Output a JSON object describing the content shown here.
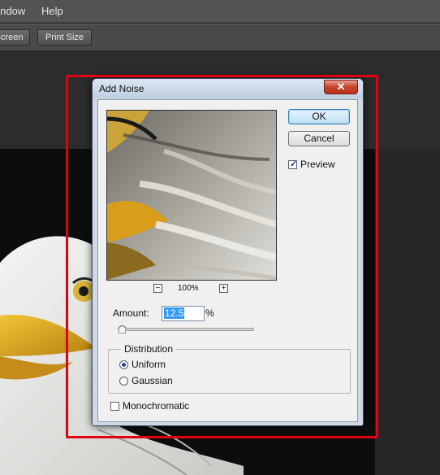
{
  "menubar": {
    "items": [
      "Window",
      "Help"
    ]
  },
  "options_bar": {
    "buttons": [
      "Fill Screen",
      "Print Size"
    ]
  },
  "dialog": {
    "title": "Add Noise",
    "close_glyph": "✕",
    "ok_label": "OK",
    "cancel_label": "Cancel",
    "preview_label": "Preview",
    "preview_checked": true,
    "zoom_minus": "−",
    "zoom_plus": "+",
    "zoom_level": "100%",
    "amount_label": "Amount:",
    "amount_value": "12.5",
    "amount_unit": "%",
    "slider_fraction": 0.03,
    "distribution_title": "Distribution",
    "distribution_options": [
      "Uniform",
      "Gaussian"
    ],
    "distribution_selected": "Uniform",
    "monochromatic_label": "Monochromatic",
    "monochromatic_checked": false
  },
  "colors": {
    "highlight": "#e00012",
    "accent_blue": "#3399ff"
  }
}
